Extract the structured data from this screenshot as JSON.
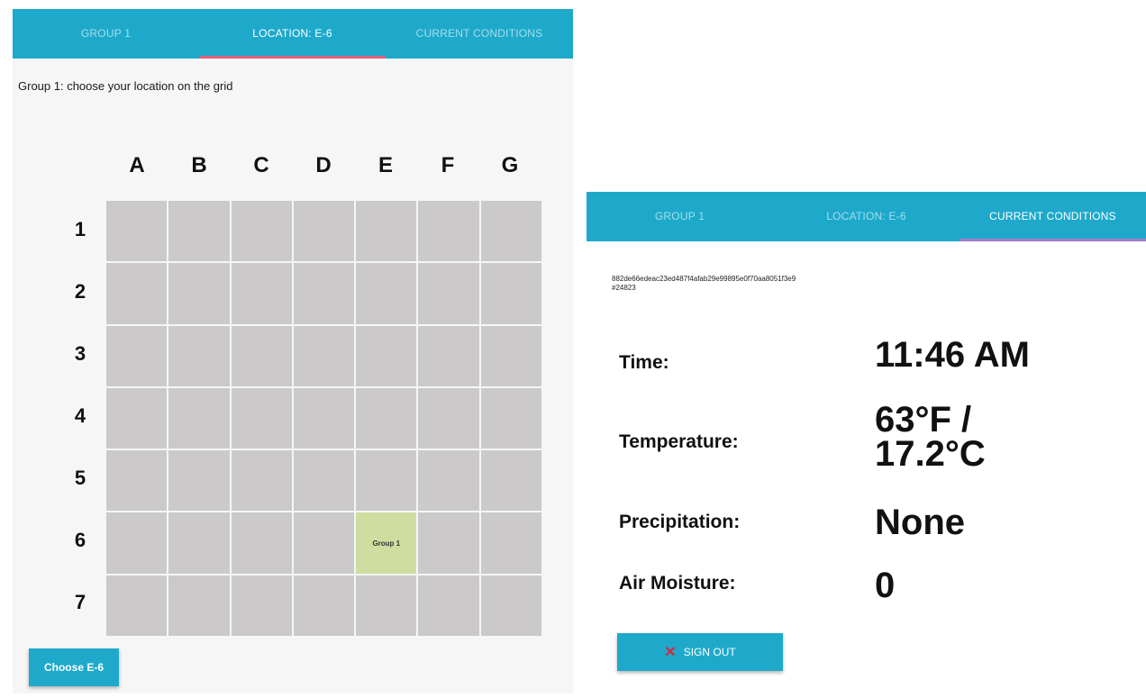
{
  "left_panel": {
    "tabs": [
      {
        "label": "GROUP 1",
        "active": false
      },
      {
        "label": "LOCATION: E-6",
        "active": true
      },
      {
        "label": "CURRENT CONDITIONS",
        "active": false
      }
    ],
    "instruction": "Group 1: choose your location on the grid",
    "grid": {
      "columns": [
        "A",
        "B",
        "C",
        "D",
        "E",
        "F",
        "G"
      ],
      "rows": [
        "1",
        "2",
        "3",
        "4",
        "5",
        "6",
        "7"
      ],
      "selected_cell": {
        "column": "E",
        "row": "6",
        "label": "Group 1"
      }
    },
    "choose_button": "Choose E-6"
  },
  "right_panel": {
    "tabs": [
      {
        "label": "GROUP 1",
        "active": false
      },
      {
        "label": "LOCATION: E-6",
        "active": false
      },
      {
        "label": "CURRENT CONDITIONS",
        "active": true
      }
    ],
    "hash": "882de66edeac23ed487f4afab29e99895e0f70aa8051f3e9",
    "hash_id": "#24823",
    "conditions": {
      "time_label": "Time:",
      "time_value": "11:46 AM",
      "temperature_label": "Temperature:",
      "temperature_value_line1": "63°F /",
      "temperature_value_line2": "17.2°C",
      "precipitation_label": "Precipitation:",
      "precipitation_value": "None",
      "air_moisture_label": "Air Moisture:",
      "air_moisture_value": "0"
    },
    "sign_out_button": "SIGN OUT"
  },
  "colors": {
    "accent": "#1ea9cb",
    "tab_underline_left": "#e4607a",
    "tab_underline_right": "#a47cc8",
    "grid_cell": "#cbc9ca",
    "selected_cell": "#cfdea0",
    "sign_out_icon": "#e0243a"
  },
  "icons": {
    "sign_out": "close-x-icon"
  }
}
